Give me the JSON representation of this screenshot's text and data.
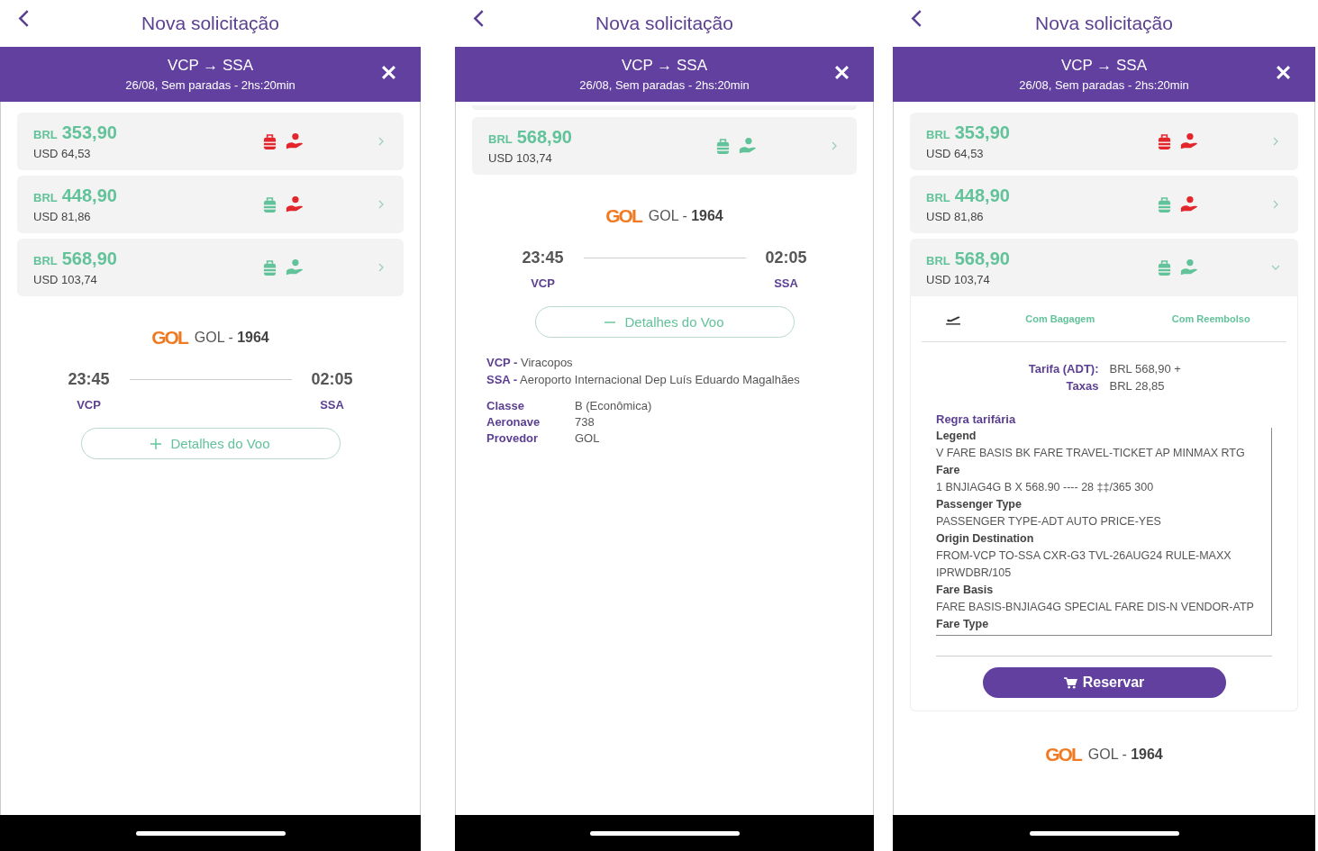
{
  "screens": [
    {
      "title": "Nova solicitação",
      "route": "VCP → SSA",
      "subtitle": "26/08, Sem paradas - 2hs:20min",
      "card_above": false,
      "fares": [
        {
          "currency": "BRL",
          "amount": "353,90",
          "usd": "USD 64,53",
          "baggage": false,
          "refund": false,
          "expanded": false
        },
        {
          "currency": "BRL",
          "amount": "448,90",
          "usd": "USD 81,86",
          "baggage": true,
          "refund": false,
          "expanded": false
        },
        {
          "currency": "BRL",
          "amount": "568,90",
          "usd": "USD 103,74",
          "baggage": true,
          "refund": true,
          "expanded": false
        }
      ],
      "flight": {
        "logo": "GOL",
        "name": "GOL - **1964**",
        "departure": "23:45",
        "arrival": "02:05",
        "from": "VCP",
        "to": "SSA"
      },
      "details_button": {
        "label": "Detalhes do Voo",
        "expanded": false
      }
    },
    {
      "title": "Nova solicitação",
      "route": "VCP → SSA",
      "subtitle": "26/08, Sem paradas - 2hs:20min",
      "card_above": true,
      "fares": [
        {
          "currency": "BRL",
          "amount": "568,90",
          "usd": "USD 103,74",
          "baggage": true,
          "refund": true,
          "expanded": false
        }
      ],
      "flight": {
        "logo": "GOL",
        "name": "GOL - **1964**",
        "departure": "23:45",
        "arrival": "02:05",
        "from": "VCP",
        "to": "SSA"
      },
      "details_button": {
        "label": "Detalhes do Voo",
        "expanded": true
      },
      "details": {
        "airports": [
          "**VCP -** Viracopos",
          "**SSA -** Aeroporto Internacional Dep Luís Eduardo Magalhães"
        ],
        "info": [
          {
            "label": "Classe",
            "value": "B (Econômica)"
          },
          {
            "label": "Aeronave",
            "value": "738"
          },
          {
            "label": "Provedor",
            "value": "GOL"
          }
        ]
      }
    },
    {
      "title": "Nova solicitação",
      "route": "VCP → SSA",
      "subtitle": "26/08, Sem paradas - 2hs:20min",
      "card_above": false,
      "fares": [
        {
          "currency": "BRL",
          "amount": "353,90",
          "usd": "USD 64,53",
          "baggage": false,
          "refund": false,
          "expanded": false
        },
        {
          "currency": "BRL",
          "amount": "448,90",
          "usd": "USD 81,86",
          "baggage": true,
          "refund": false,
          "expanded": false
        },
        {
          "currency": "BRL",
          "amount": "568,90",
          "usd": "USD 103,74",
          "baggage": true,
          "refund": true,
          "expanded": true,
          "detail": {
            "tabs": [
              "Com Bagagem",
              "Com Reembolso"
            ],
            "charges": [
              {
                "label": "Tarifa (ADT):",
                "value": "BRL 568,90 +"
              },
              {
                "label": "Taxas",
                "value": "BRL 28,85"
              }
            ],
            "rules_title": "Regra tarifária",
            "rules": [
              {
                "heading": "Legend",
                "text": "V FARE BASIS BK FARE TRAVEL-TICKET AP MINMAX RTG"
              },
              {
                "heading": "Fare",
                "text": "1 BNJIAG4G B X 568.90 ---- 28 ‡‡/365 300"
              },
              {
                "heading": "Passenger Type",
                "text": "PASSENGER TYPE-ADT AUTO PRICE-YES"
              },
              {
                "heading": "Origin Destination",
                "text": "FROM-VCP TO-SSA CXR-G3 TVL-26AUG24 RULE-MAXX IPRWDBR/105"
              },
              {
                "heading": "Fare Basis",
                "text": "FARE BASIS-BNJIAG4G SPECIAL FARE DIS-N VENDOR-ATP"
              },
              {
                "heading": "Fare Type"
              }
            ],
            "button": "Reservar"
          }
        }
      ],
      "flight": {
        "logo": "GOL",
        "name": "GOL - **1964**"
      }
    }
  ]
}
